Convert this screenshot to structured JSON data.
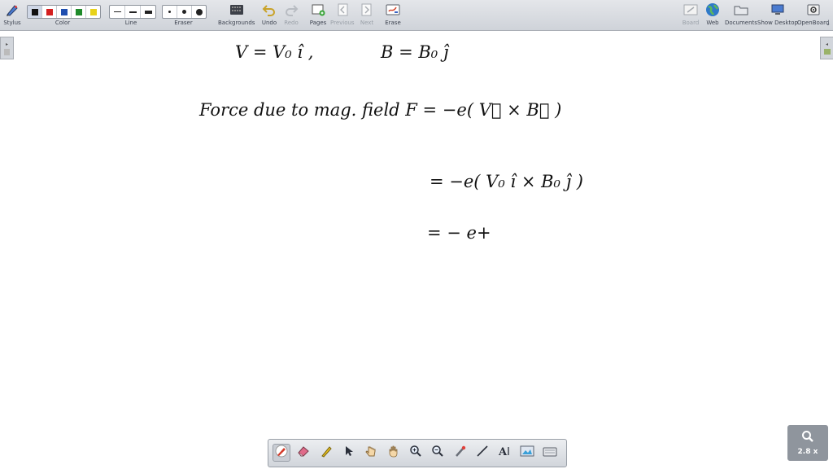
{
  "toolbar": {
    "stylus_label": "Stylus",
    "color_label": "Color",
    "line_label": "Line",
    "eraser_label": "Eraser",
    "backgrounds_label": "Backgrounds",
    "undo_label": "Undo",
    "redo_label": "Redo",
    "pages_label": "Pages",
    "previous_label": "Previous",
    "next_label": "Next",
    "erase_label": "Erase",
    "board_label": "Board",
    "web_label": "Web",
    "documents_label": "Documents",
    "show_desktop_label": "Show Desktop",
    "openboard_label": "OpenBoard",
    "colors": [
      "#111111",
      "#d42020",
      "#1f4fb0",
      "#1e8a2a",
      "#e8d21a"
    ]
  },
  "canvas": {
    "line1_velocity": "V = V₀ î ,",
    "line1_field": "B = B₀ ĵ",
    "line2": "Force due to mag. field  F  =  −e( V⃗ × B⃗ )",
    "line3": "= −e( V₀ î × B₀ ĵ )",
    "line4": "= − e+"
  },
  "zoom": {
    "level": "2.8 x"
  }
}
